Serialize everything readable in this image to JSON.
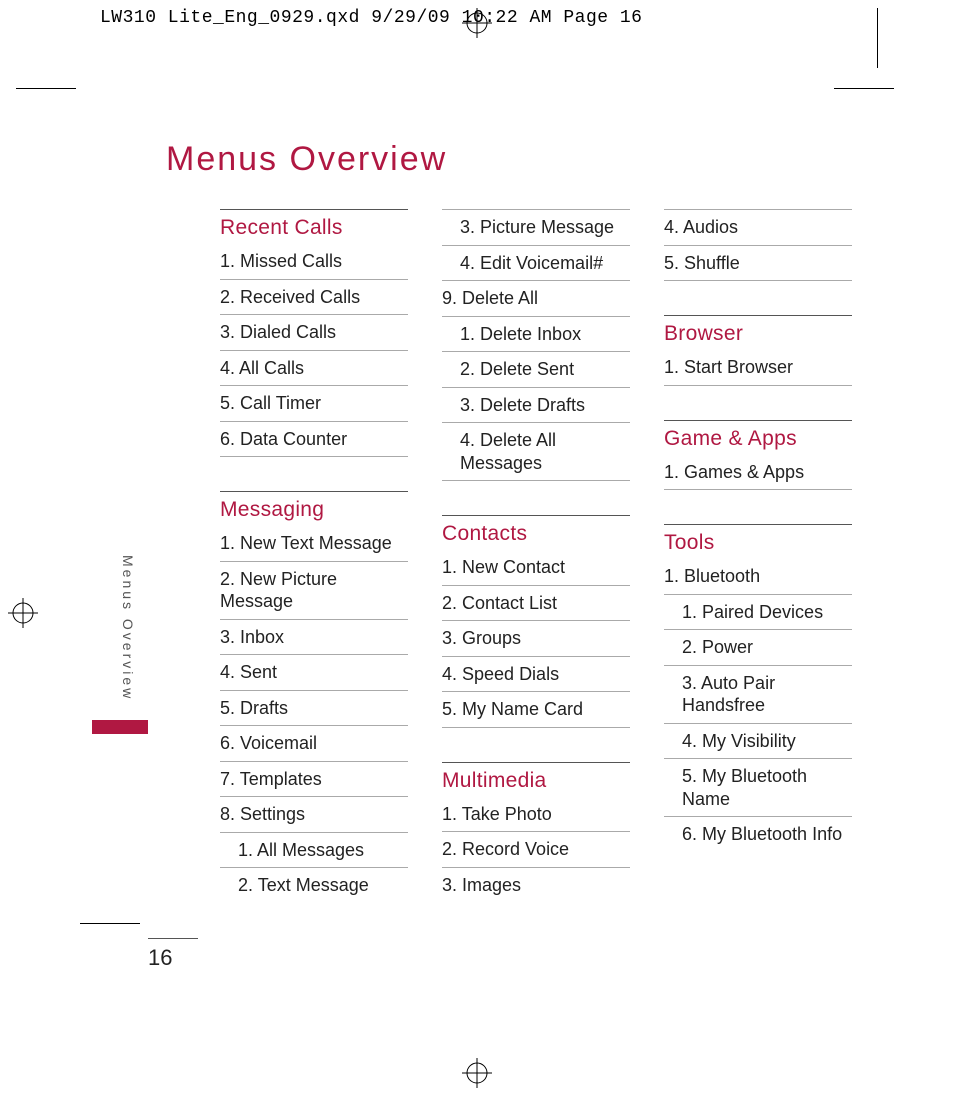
{
  "slug": "LW310 Lite_Eng_0929.qxd  9/29/09  10:22 AM  Page 16",
  "title": "Menus Overview",
  "side_tab": "Menus Overview",
  "page_number": "16",
  "col1": {
    "s1_title": "Recent Calls",
    "s1_i1": "1. Missed Calls",
    "s1_i2": "2. Received Calls",
    "s1_i3": "3. Dialed Calls",
    "s1_i4": "4. All Calls",
    "s1_i5": "5. Call Timer",
    "s1_i6": "6. Data Counter",
    "s2_title": "Messaging",
    "s2_i1": "1. New Text Message",
    "s2_i2": "2. New Picture Message",
    "s2_i3": "3. Inbox",
    "s2_i4": "4. Sent",
    "s2_i5": "5. Drafts",
    "s2_i6": "6. Voicemail",
    "s2_i7": "7.  Templates",
    "s2_i8": "8. Settings",
    "s2_i8_1": "1. All Messages",
    "s2_i8_2": "2. Text Message"
  },
  "col2": {
    "c1": "3. Picture Message",
    "c2": "4. Edit Voicemail#",
    "c3": "9. Delete All",
    "c3_1": "1. Delete Inbox",
    "c3_2": "2. Delete Sent",
    "c3_3": "3. Delete Drafts",
    "c3_4": "4. Delete All Messages",
    "s1_title": "Contacts",
    "s1_i1": "1. New Contact",
    "s1_i2": "2. Contact List",
    "s1_i3": "3. Groups",
    "s1_i4": "4. Speed Dials",
    "s1_i5": "5. My Name Card",
    "s2_title": "Multimedia",
    "s2_i1": "1.  Take Photo",
    "s2_i2": "2. Record Voice",
    "s2_i3": "3. Images"
  },
  "col3": {
    "c1": "4. Audios",
    "c2": "5. Shuffle",
    "s1_title": "Browser",
    "s1_i1": "1. Start Browser",
    "s2_title": "Game & Apps",
    "s2_i1": "1. Games & Apps",
    "s3_title": "Tools",
    "s3_i1": "1. Bluetooth",
    "s3_i1_1": "1. Paired Devices",
    "s3_i1_2": "2. Power",
    "s3_i1_3": "3. Auto Pair Handsfree",
    "s3_i1_4": "4. My Visibility",
    "s3_i1_5": "5. My Bluetooth Name",
    "s3_i1_6": "6. My Bluetooth Info"
  }
}
